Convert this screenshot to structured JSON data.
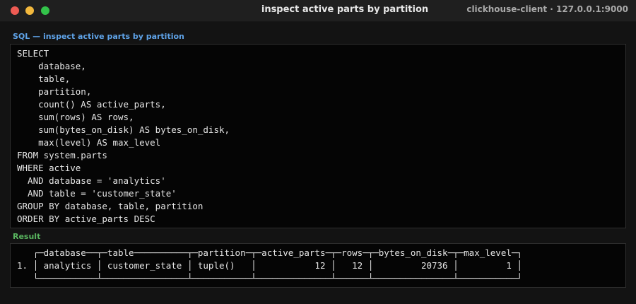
{
  "window": {
    "title": "inspect active parts by partition",
    "connection": "clickhouse-client · 127.0.0.1:9000"
  },
  "sql_section": {
    "label": "SQL — inspect active parts by partition",
    "query": "SELECT\n    database,\n    table,\n    partition,\n    count() AS active_parts,\n    sum(rows) AS rows,\n    sum(bytes_on_disk) AS bytes_on_disk,\n    max(level) AS max_level\nFROM system.parts\nWHERE active\n  AND database = 'analytics'\n  AND table = 'customer_state'\nGROUP BY database, table, partition\nORDER BY active_parts DESC"
  },
  "result_section": {
    "label": "Result",
    "output": "   ┌─database──┬─table──────────┬─partition─┬─active_parts─┬─rows─┬─bytes_on_disk─┬─max_level─┐\n1. │ analytics │ customer_state │ tuple()   │           12 │   12 │         20736 │         1 │\n   └───────────┴────────────────┴───────────┴──────────────┴──────┴───────────────┴───────────┘"
  },
  "colors": {
    "sql_label": "#5fa3e8",
    "result_label": "#58b35e",
    "close": "#ee5b53",
    "minimize": "#f2b83d",
    "zoom": "#33c34a"
  }
}
